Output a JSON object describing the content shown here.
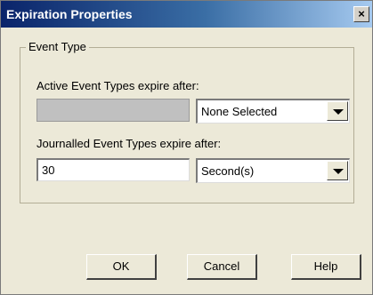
{
  "window": {
    "title": "Expiration Properties",
    "close_glyph": "×"
  },
  "event_type_group": {
    "legend": "Event Type",
    "active": {
      "label": "Active Event Types expire after:",
      "value": "",
      "unit": "None Selected"
    },
    "journalled": {
      "label": "Journalled Event Types expire after:",
      "value": "30",
      "unit": "Second(s)"
    }
  },
  "buttons": {
    "ok": "OK",
    "cancel": "Cancel",
    "help": "Help"
  }
}
